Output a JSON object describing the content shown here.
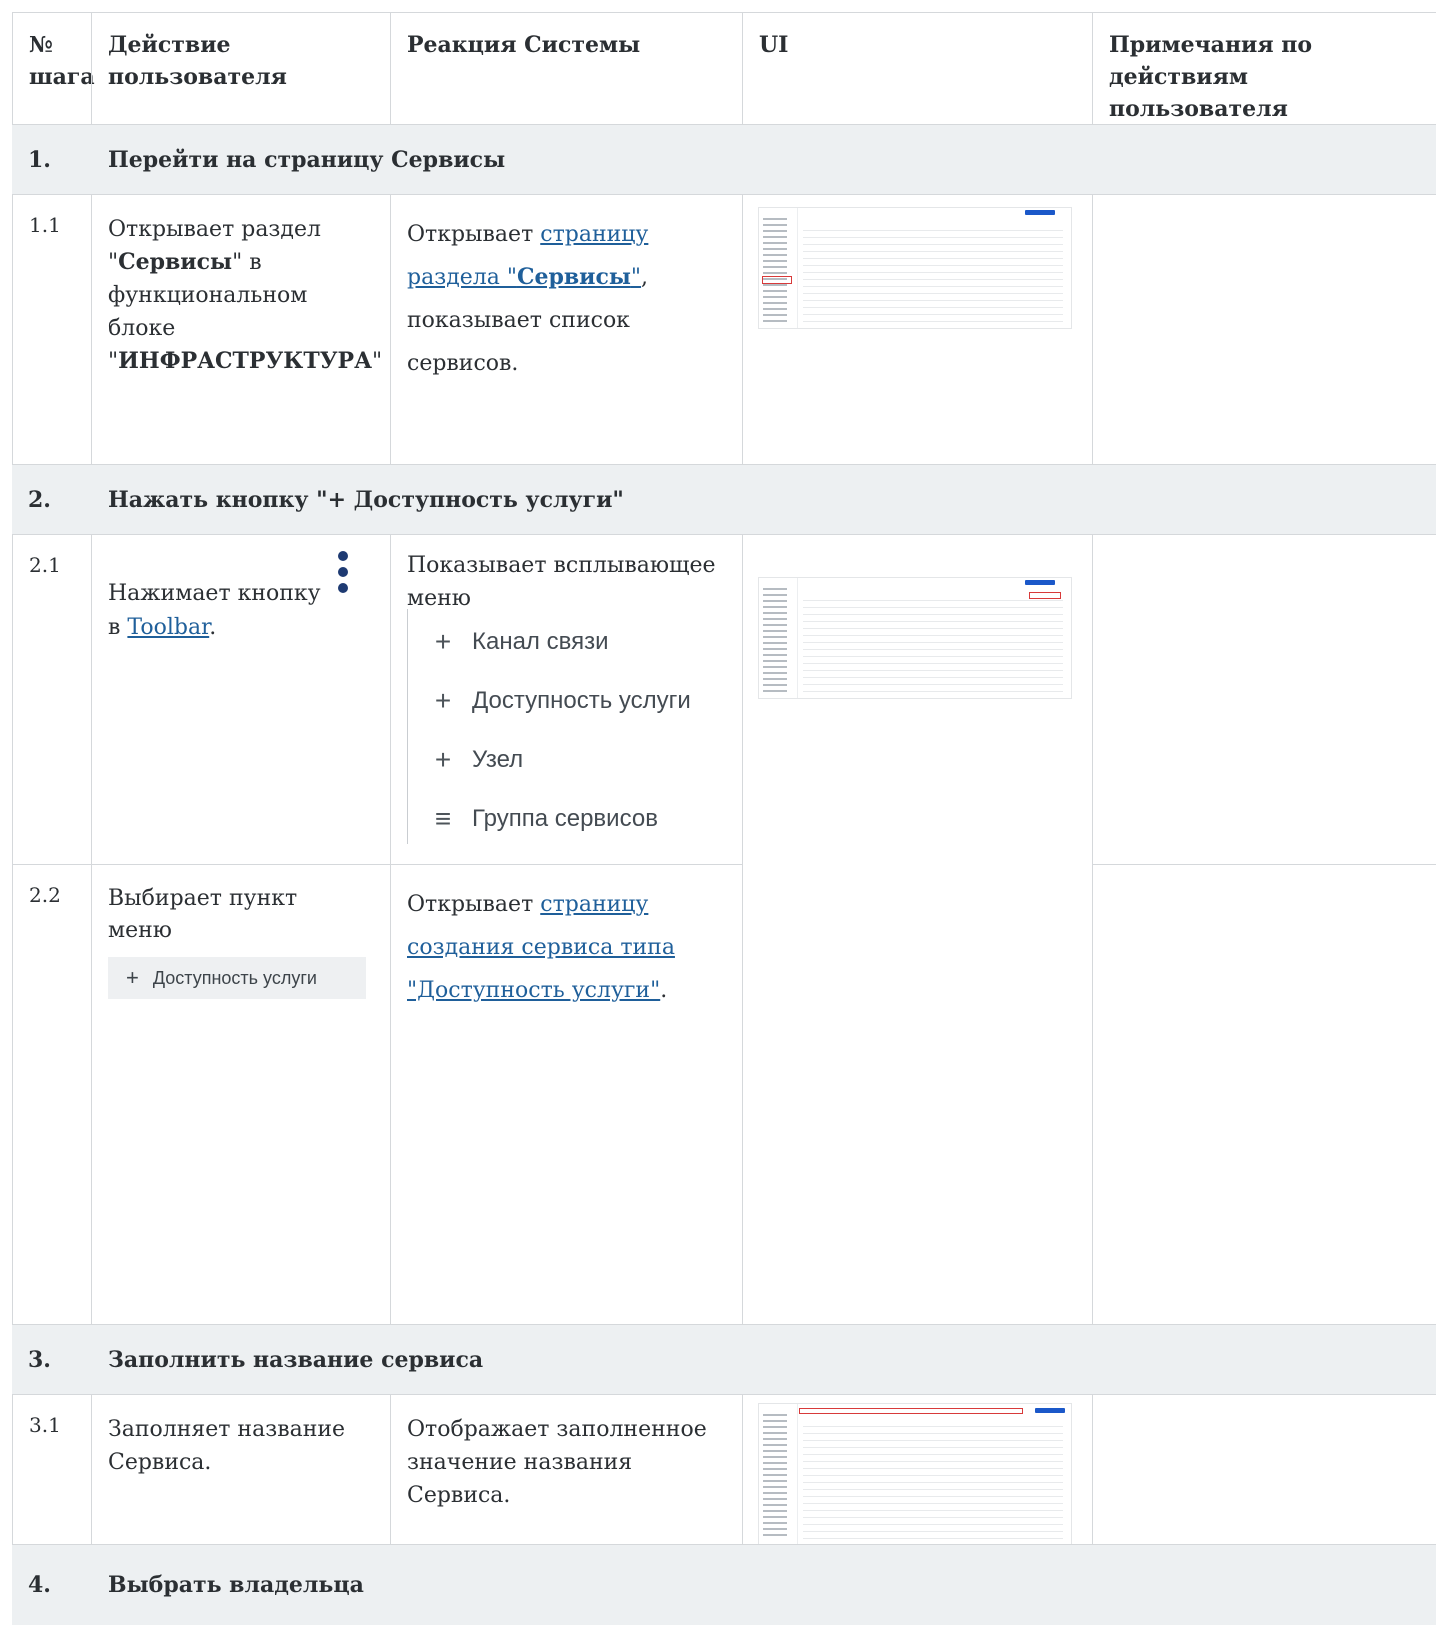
{
  "headers": {
    "step_no": "№ шага",
    "user_action": "Действие пользователя",
    "system_reaction": "Реакция Системы",
    "ui": "UI",
    "notes": "Примечания по действиям пользователя"
  },
  "groups": [
    {
      "num": "1.",
      "title": "Перейти на страницу Сервисы"
    },
    {
      "num": "2.",
      "title": "Нажать кнопку \"+ Доступность услуги\""
    },
    {
      "num": "3.",
      "title": "Заполнить название сервиса"
    },
    {
      "num": "4.",
      "title": "Выбрать владельца"
    }
  ],
  "step_1_1": {
    "num": "1.1",
    "action_1": "Открывает раздел \"",
    "action_bold_1": "Сервисы",
    "action_2": "\" в функциональном блоке \"",
    "action_bold_2": "ИНФРАСТРУКТУРА",
    "action_3": "\"",
    "reaction_pre": "Открывает ",
    "reaction_link_1": "страницу раздела \"",
    "reaction_link_bold": "Сервисы",
    "reaction_link_2": "\"",
    "reaction_post": ", показывает список сервисов."
  },
  "step_2_1": {
    "num": "2.1",
    "action_pre": "Нажимает кнопку",
    "action_mid": "в ",
    "action_link": "Toolbar",
    "action_post": ".",
    "reaction": "Показывает всплывающее меню",
    "menu_items": [
      {
        "icon": "+",
        "label": "Канал связи"
      },
      {
        "icon": "+",
        "label": "Доступность услуги"
      },
      {
        "icon": "+",
        "label": "Узел"
      },
      {
        "icon": "≡",
        "label": "Группа сервисов"
      }
    ]
  },
  "step_2_2": {
    "num": "2.2",
    "action": "Выбирает пункт меню",
    "chip_icon": "+",
    "chip_label": "Доступность услуги",
    "reaction_pre": "Открывает ",
    "reaction_link": "страницу создания сервиса типа \"Доступность услуги\"",
    "reaction_post": "."
  },
  "step_3_1": {
    "num": "3.1",
    "action": "Заполняет название Сервиса.",
    "reaction": "Отображает заполненное значение названия Сервиса."
  },
  "colors": {
    "group_bg": "#edf0f2",
    "border": "#d5d8db",
    "link": "#1f5f9a",
    "accent_button": "#1b58c9",
    "highlight": "#d83a3a"
  }
}
